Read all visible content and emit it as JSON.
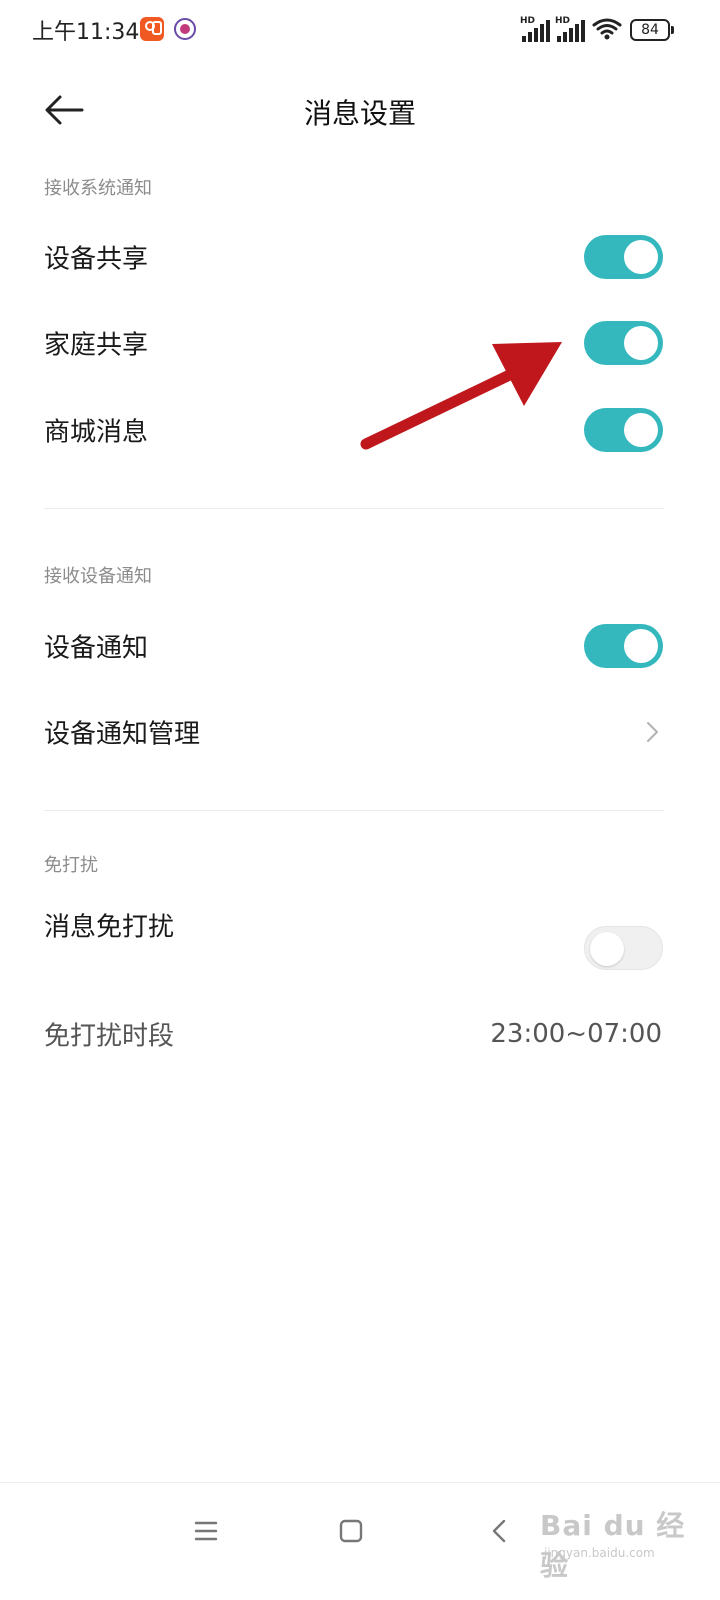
{
  "status_bar": {
    "time": "上午11:34",
    "battery": "84",
    "signal_1_label": "HD",
    "signal_2_label": "HD",
    "icons": [
      "app-notification-icon",
      "app-notification-icon-2",
      "signal-icon",
      "signal-icon",
      "wifi-icon",
      "battery-icon"
    ]
  },
  "header": {
    "title": "消息设置",
    "back_icon": "back-arrow-icon"
  },
  "sections": {
    "system": {
      "label": "接收系统通知",
      "items": [
        {
          "label": "设备共享",
          "toggle": true
        },
        {
          "label": "家庭共享",
          "toggle": true
        },
        {
          "label": "商城消息",
          "toggle": true
        }
      ]
    },
    "device": {
      "label": "接收设备通知",
      "items": [
        {
          "label": "设备通知",
          "toggle": true
        },
        {
          "label": "设备通知管理",
          "chevron": "chevron-right-icon"
        }
      ]
    },
    "dnd": {
      "label": "免打扰",
      "items": [
        {
          "label": "消息免打扰",
          "toggle": false
        },
        {
          "label": "免打扰时段",
          "value": "23:00~07:00"
        }
      ]
    }
  },
  "colors": {
    "toggle_on": "#34b8bd",
    "toggle_off": "#f0f0f0",
    "annotation_arrow": "#c0171c"
  },
  "nav_bar": {
    "icons": [
      "menu-icon",
      "home-icon",
      "back-icon"
    ]
  },
  "watermark": {
    "text": "Bai du 经验",
    "sub": "jingyan.baidu.com"
  }
}
